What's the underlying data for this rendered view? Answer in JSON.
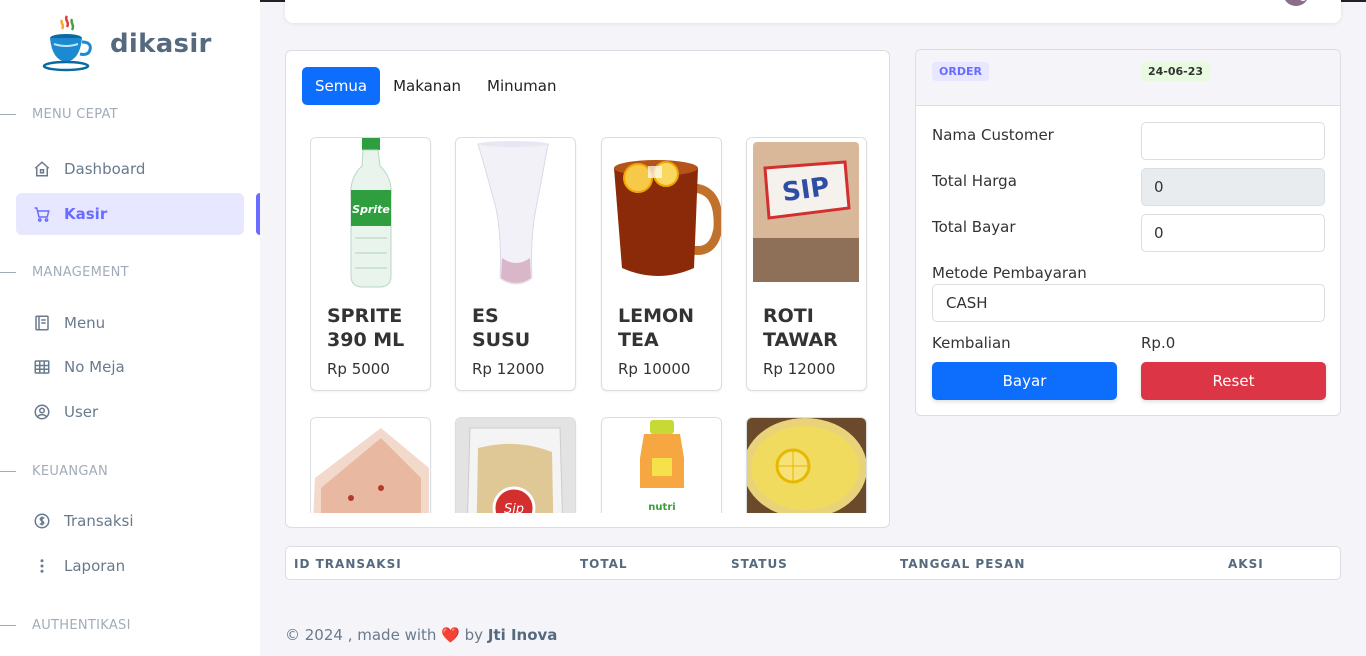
{
  "brand": {
    "name": "dikasir",
    "logo": "coffee-cup-logo"
  },
  "sidebar": {
    "sections": [
      {
        "title": "MENU CEPAT"
      },
      {
        "title": "MANAGEMENT"
      },
      {
        "title": "KEUANGAN"
      },
      {
        "title": "AUTHENTIKASI"
      }
    ],
    "items": [
      {
        "label": "Dashboard",
        "icon": "home-icon"
      },
      {
        "label": "Kasir",
        "icon": "cart-icon",
        "active": true
      },
      {
        "label": "Menu",
        "icon": "book-icon"
      },
      {
        "label": "No Meja",
        "icon": "table-grid-icon"
      },
      {
        "label": "User",
        "icon": "user-circle-icon"
      },
      {
        "label": "Transaksi",
        "icon": "dollar-circle-icon"
      },
      {
        "label": "Laporan",
        "icon": "vertical-dots-icon"
      }
    ]
  },
  "tabs": [
    {
      "label": "Semua",
      "active": true
    },
    {
      "label": "Makanan"
    },
    {
      "label": "Minuman"
    }
  ],
  "products": [
    {
      "name": "SPRITE 390 ML",
      "price": "Rp 5000"
    },
    {
      "name": "ES SUSU",
      "price": "Rp 12000"
    },
    {
      "name": "LEMON TEA",
      "price": "Rp 10000"
    },
    {
      "name": "ROTI TAWAR",
      "price": "Rp 12000"
    },
    {
      "name": "",
      "price": ""
    },
    {
      "name": "",
      "price": ""
    },
    {
      "name": "",
      "price": ""
    },
    {
      "name": "",
      "price": ""
    }
  ],
  "order": {
    "badge": "ORDER",
    "date": "24-06-23",
    "customer_label": "Nama Customer",
    "customer_value": "",
    "total_harga_label": "Total Harga",
    "total_harga_value": "0",
    "total_bayar_label": "Total Bayar",
    "total_bayar_value": "0",
    "metode_label": "Metode Pembayaran",
    "metode_value": "CASH",
    "kembalian_label": "Kembalian",
    "kembalian_value": "Rp.0",
    "bayar_button": "Bayar",
    "reset_button": "Reset"
  },
  "table": {
    "headers": [
      "ID TRANSAKSI",
      "TOTAL",
      "STATUS",
      "TANGGAL PESAN",
      "AKSI"
    ]
  },
  "footer": {
    "prefix": "© 2024 , made with",
    "by": "by",
    "author": "Jti Inova"
  },
  "colors": {
    "primary": "#0d6efd",
    "danger": "#dc3545",
    "accent": "#696cff"
  }
}
